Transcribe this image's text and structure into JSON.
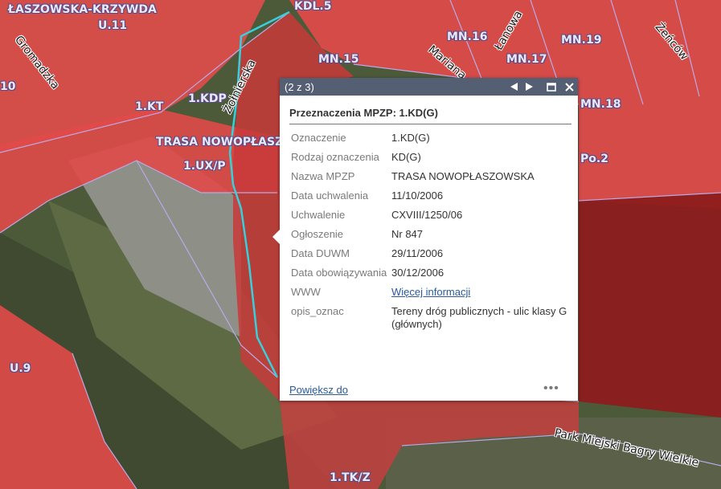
{
  "map": {
    "zone_labels": [
      "ŁASZOWSKA-KRZYWDA",
      "U.11",
      "KDL.5",
      "MN.16",
      "MN.15",
      "MN.19",
      "MN.17",
      "MN.18",
      "1.KT",
      "1.KDP",
      "TRASA NOWOPŁASZOWSKA",
      "1.UX/P",
      "10",
      "U.9",
      "1.TK/Z",
      "Po.2"
    ],
    "street_labels": [
      "Gromadzka",
      "Żołnierska",
      "Łanowa",
      "Mariana",
      "Żeńców",
      "Park Miejski Bagry Wielkie"
    ],
    "colors": {
      "zone_fill": "#e64b4b",
      "zone_outline": "#9b86d6",
      "water": "#8c1c1c",
      "selection": "#36d0dc"
    }
  },
  "popup": {
    "feature_count": "(2 z 3)",
    "controls": {
      "previous_icon": "triangle-left",
      "next_icon": "triangle-right",
      "maximize_icon": "square-outline",
      "close_icon": "x"
    },
    "title": "Przeznaczenia MPZP: 1.KD(G)",
    "attributes": [
      {
        "key": "Oznaczenie",
        "value": "1.KD(G)"
      },
      {
        "key": "Rodzaj oznaczenia",
        "value": "KD(G)"
      },
      {
        "key": "Nazwa MPZP",
        "value": "TRASA NOWOPŁASZOWSKA"
      },
      {
        "key": "Data uchwalenia",
        "value": "11/10/2006"
      },
      {
        "key": "Uchwalenie",
        "value": "CXVIII/1250/06"
      },
      {
        "key": "Ogłoszenie",
        "value": "Nr 847"
      },
      {
        "key": "Data DUWM",
        "value": "29/11/2006"
      },
      {
        "key": "Data obowiązywania",
        "value": "30/12/2006"
      },
      {
        "key": "WWW",
        "value": "Więcej informacji"
      },
      {
        "key": "opis_oznac",
        "value": "Tereny dróg publicznych - ulic klasy G (głównych)"
      }
    ],
    "zoom_link": "Powiększ do",
    "more_icon": "ellipsis"
  }
}
